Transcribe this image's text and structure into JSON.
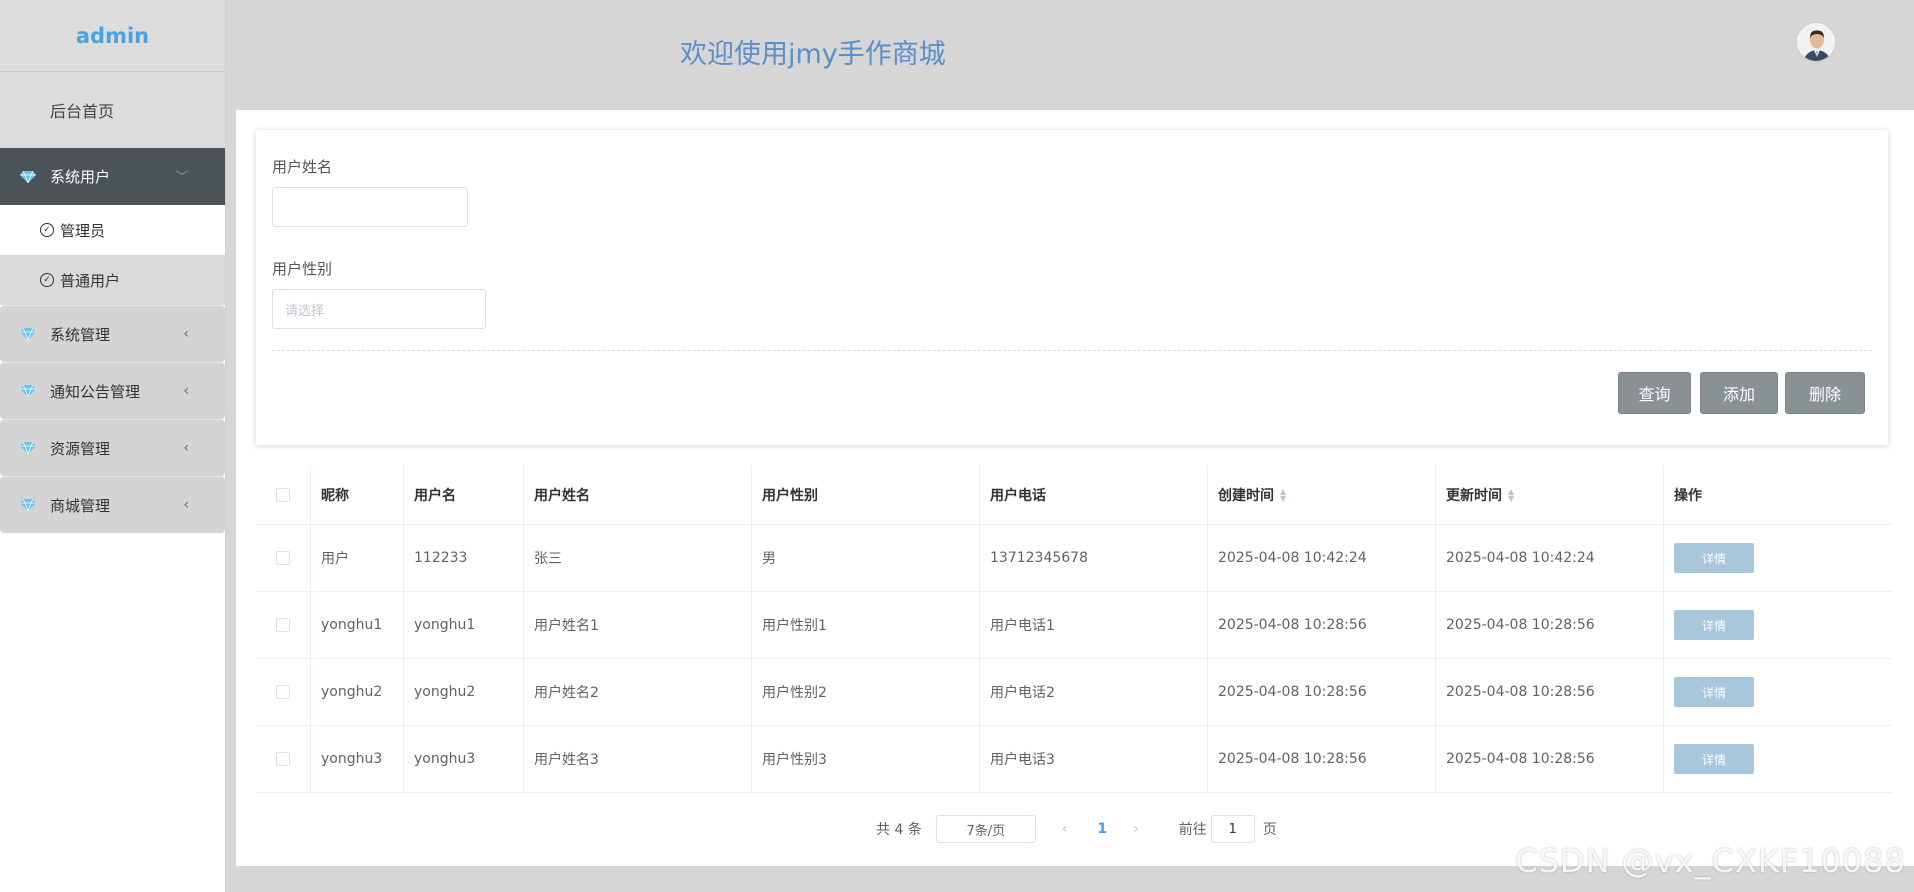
{
  "sidebar": {
    "brand": "admin",
    "home": "后台首页",
    "groups": [
      {
        "label": "系统用户",
        "arrow": "﹀"
      },
      {
        "label": "系统管理",
        "arrow": "‹"
      },
      {
        "label": "通知公告管理",
        "arrow": "‹"
      },
      {
        "label": "资源管理",
        "arrow": "‹"
      },
      {
        "label": "商城管理",
        "arrow": "‹"
      }
    ],
    "sub_items": [
      {
        "label": "管理员"
      },
      {
        "label": "普通用户"
      }
    ]
  },
  "header": {
    "title": "欢迎使用jmy手作商城",
    "avatar_icon": "user-avatar"
  },
  "search": {
    "name_label": "用户姓名",
    "name_value": "",
    "gender_label": "用户性别",
    "gender_placeholder": "请选择",
    "query_button": "查询",
    "add_button": "添加",
    "delete_button": "删除"
  },
  "table": {
    "columns": [
      "昵称",
      "用户名",
      "用户姓名",
      "用户性别",
      "用户电话",
      "创建时间",
      "更新时间",
      "操作"
    ],
    "rows": [
      {
        "nickname": "用户",
        "username": "112233",
        "realname": "张三",
        "gender": "男",
        "phone": "13712345678",
        "created": "2025-04-08 10:42:24",
        "updated": "2025-04-08 10:42:24",
        "action": "详情"
      },
      {
        "nickname": "yonghu1",
        "username": "yonghu1",
        "realname": "用户姓名1",
        "gender": "用户性别1",
        "phone": "用户电话1",
        "created": "2025-04-08 10:28:56",
        "updated": "2025-04-08 10:28:56",
        "action": "详情"
      },
      {
        "nickname": "yonghu2",
        "username": "yonghu2",
        "realname": "用户姓名2",
        "gender": "用户性别2",
        "phone": "用户电话2",
        "created": "2025-04-08 10:28:56",
        "updated": "2025-04-08 10:28:56",
        "action": "详情"
      },
      {
        "nickname": "yonghu3",
        "username": "yonghu3",
        "realname": "用户姓名3",
        "gender": "用户性别3",
        "phone": "用户电话3",
        "created": "2025-04-08 10:28:56",
        "updated": "2025-04-08 10:28:56",
        "action": "详情"
      }
    ]
  },
  "pager": {
    "total": "共 4 条",
    "page_size": "7条/页",
    "prev": "‹",
    "current_page": "1",
    "next": "›",
    "goto_prefix": "前往",
    "goto_value": "1",
    "goto_suffix": "页"
  },
  "watermark": "CSDN @vx_CXKF10088",
  "colors": {
    "accent": "#4aa3e0",
    "title": "#5b8fc7",
    "active_menu": "#4c5356",
    "button": "#8a9194",
    "detail_button": "#a8c6dc"
  }
}
